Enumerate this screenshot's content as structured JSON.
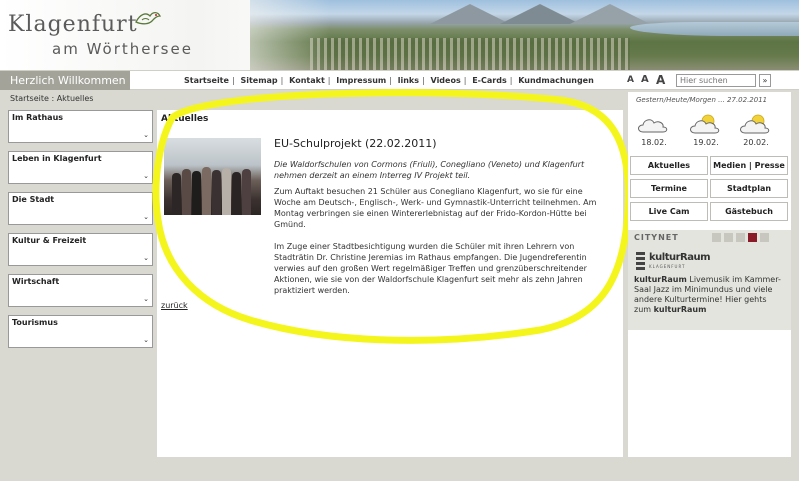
{
  "header": {
    "logo_line1": "Klagenfurt",
    "logo_line2": "am Wörthersee"
  },
  "navbar": {
    "welcome": "Herzlich Willkommen",
    "links": [
      "Startseite",
      "Sitemap",
      "Kontakt",
      "Impressum",
      "links",
      "Videos",
      "E-Cards",
      "Kundmachungen"
    ],
    "font_sizes": [
      "A",
      "A",
      "A"
    ],
    "search_placeholder": "Hier suchen",
    "search_go": "»"
  },
  "breadcrumb": "Startseite : Aktuelles",
  "sidebar": {
    "items": [
      {
        "label": "Im Rathaus"
      },
      {
        "label": "Leben in Klagenfurt"
      },
      {
        "label": "Die Stadt"
      },
      {
        "label": "Kultur & Freizeit"
      },
      {
        "label": "Wirtschaft"
      },
      {
        "label": "Tourismus"
      }
    ]
  },
  "main": {
    "heading": "Aktuelles",
    "article_title": "EU-Schulprojekt (22.02.2011)",
    "lead": "Die Waldorfschulen von Cormons (Friuli), Conegliano (Veneto) und Klagenfurt nehmen derzeit an einem Interreg IV Projekt teil.",
    "para1": "Zum Auftakt besuchen 21 Schüler aus Conegliano Klagenfurt, wo sie für eine Woche am Deutsch-, Englisch-, Werk- und Gymnastik-Unterricht teilnehmen. Am Montag verbringen sie einen Wintererlebnistag auf der Frido-Kordon-Hütte bei Gmünd.",
    "para2": "Im Zuge einer Stadtbesichtigung wurden die Schüler mit ihren Lehrern von Stadträtin Dr. Christine Jeremias im Rathaus empfangen. Die Jugendreferentin verwies auf den großen Wert regelmäßiger Treffen und grenzüberschreitender Aktionen, wie sie von der Waldorfschule Klagenfurt seit mehr als zehn Jahren praktiziert werden.",
    "back_link": "zurück"
  },
  "right": {
    "weather_date": "Gestern/Heute/Morgen ... 27.02.2011",
    "weather": [
      {
        "date": "18.02.",
        "icon": "cloud-icon"
      },
      {
        "date": "19.02.",
        "icon": "sun-cloud-icon"
      },
      {
        "date": "20.02.",
        "icon": "sun-cloud-icon"
      }
    ],
    "quick_links": [
      "Aktuelles",
      "Medien | Presse",
      "Termine",
      "Stadtplan",
      "Live Cam",
      "Gästebuch"
    ],
    "citynet_title": "CITYNET",
    "citynet_brand": "kulturRaum",
    "citynet_sub": "KLAGENFURT",
    "citynet_text_bold1": "kulturRaum",
    "citynet_text": " Livemusik im Kammer-Saal Jazz im Minimundus und viele andere Kulturtermine! Hier gehts zum",
    "citynet_text_bold2": "kulturRaum"
  },
  "colors": {
    "welcome_bg": "#a3a39a",
    "active_dot": "#8b1a28",
    "highlight": "#f5f51e"
  }
}
